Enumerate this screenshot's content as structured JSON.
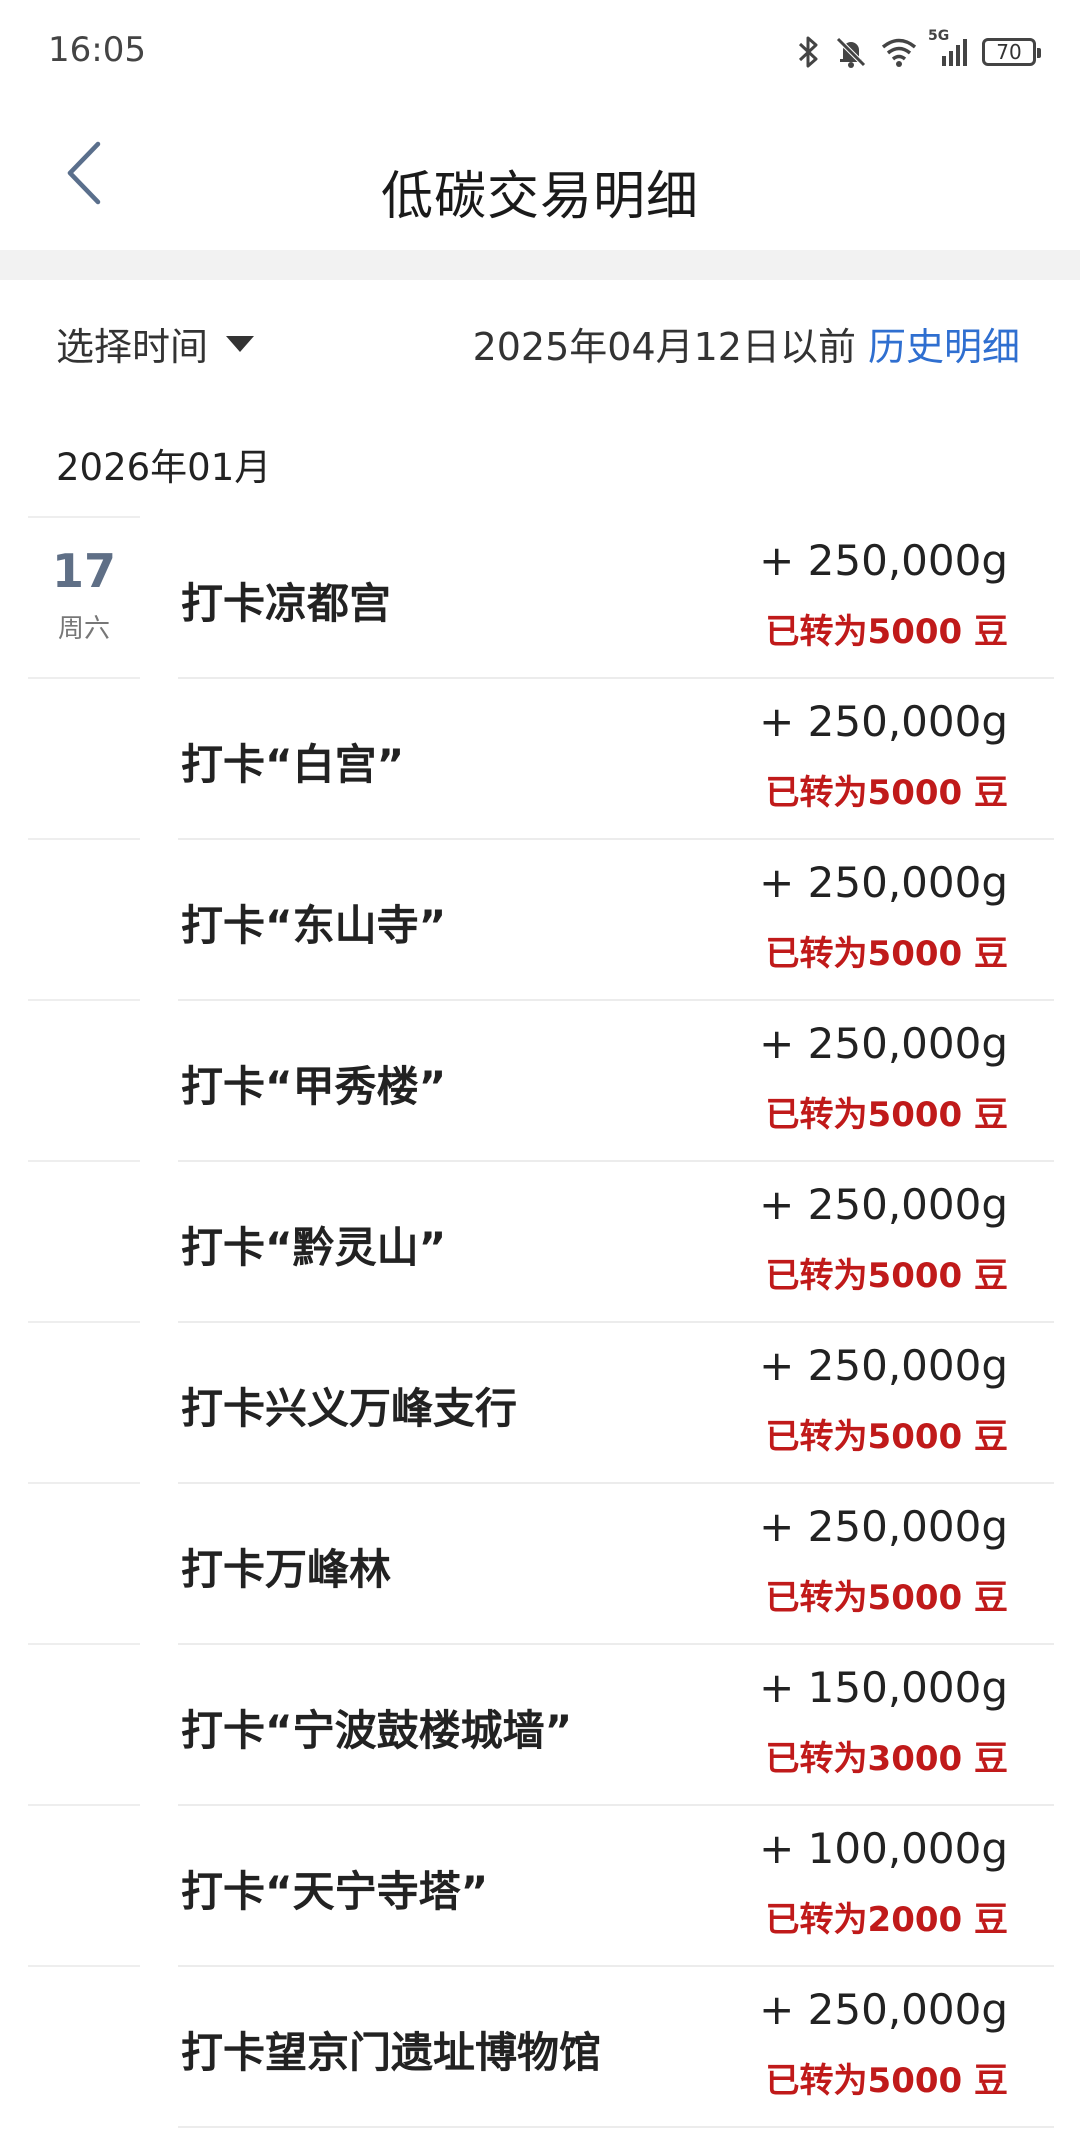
{
  "status_bar": {
    "time": "16:05",
    "network": "5G",
    "battery": "70"
  },
  "header": {
    "title": "低碳交易明细"
  },
  "filter": {
    "select_time_label": "选择时间",
    "history_note": "2025年04月12日以前",
    "history_link": "历史明细"
  },
  "month_label": "2026年01月",
  "date_group": {
    "day": "17",
    "weekday": "周六"
  },
  "colors": {
    "accent_blue": "#2f6fd0",
    "converted_red": "#c01a1a",
    "day_number": "#5f6f86"
  },
  "transactions": [
    {
      "title": "打卡凉都宫",
      "amount": "+ 250,000g",
      "converted": "已转为5000 豆"
    },
    {
      "title": "打卡“白宫”",
      "amount": "+ 250,000g",
      "converted": "已转为5000 豆"
    },
    {
      "title": "打卡“东山寺”",
      "amount": "+ 250,000g",
      "converted": "已转为5000 豆"
    },
    {
      "title": "打卡“甲秀楼”",
      "amount": "+ 250,000g",
      "converted": "已转为5000 豆"
    },
    {
      "title": "打卡“黔灵山”",
      "amount": "+ 250,000g",
      "converted": "已转为5000 豆"
    },
    {
      "title": "打卡兴义万峰支行",
      "amount": "+ 250,000g",
      "converted": "已转为5000 豆"
    },
    {
      "title": "打卡万峰林",
      "amount": "+ 250,000g",
      "converted": "已转为5000 豆"
    },
    {
      "title": "打卡“宁波鼓楼城墙”",
      "amount": "+ 150,000g",
      "converted": "已转为3000 豆"
    },
    {
      "title": "打卡“天宁寺塔”",
      "amount": "+ 100,000g",
      "converted": "已转为2000 豆"
    },
    {
      "title": "打卡望京门遗址博物馆",
      "amount": "+ 250,000g",
      "converted": "已转为5000 豆"
    }
  ]
}
